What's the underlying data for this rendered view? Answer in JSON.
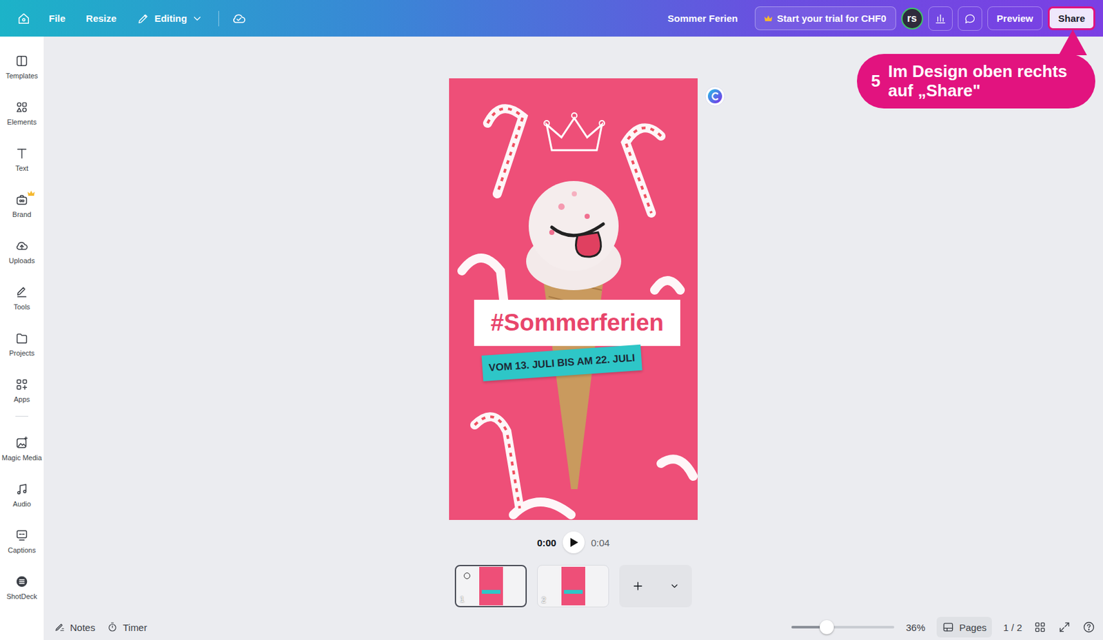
{
  "topbar": {
    "menu": [
      {
        "label": "File"
      },
      {
        "label": "Resize"
      }
    ],
    "editing": "Editing",
    "title": "Sommer Ferien",
    "trial": "Start your trial for CHF0",
    "avatar": "rs",
    "preview": "Preview",
    "share": "Share"
  },
  "sidebar": {
    "items": [
      {
        "label": "Templates",
        "premium": false
      },
      {
        "label": "Elements",
        "premium": false
      },
      {
        "label": "Text",
        "premium": false
      },
      {
        "label": "Brand",
        "premium": true
      },
      {
        "label": "Uploads",
        "premium": false
      },
      {
        "label": "Tools",
        "premium": false
      },
      {
        "label": "Projects",
        "premium": false
      },
      {
        "label": "Apps",
        "premium": false
      },
      {
        "label": "Magic Media",
        "premium": false
      },
      {
        "label": "Audio",
        "premium": false
      },
      {
        "label": "Captions",
        "premium": false
      },
      {
        "label": "ShotDeck",
        "premium": false
      }
    ]
  },
  "design": {
    "title_text": "#Sommerferien",
    "date_text": "VOM 13. JULI BIS AM 22. JULI"
  },
  "playback": {
    "current": "0:00",
    "total": "0:04"
  },
  "pages": [
    {
      "number": "1",
      "selected": true
    },
    {
      "number": "2",
      "selected": false
    }
  ],
  "bottom_bar": {
    "notes": "Notes",
    "timer": "Timer",
    "zoom": {
      "level": 0.34,
      "reading": "36%"
    },
    "pages": "Pages",
    "page_count": "1 / 2"
  },
  "callout": {
    "step": "5",
    "text": "Im Design oben rechts auf „Share\""
  }
}
